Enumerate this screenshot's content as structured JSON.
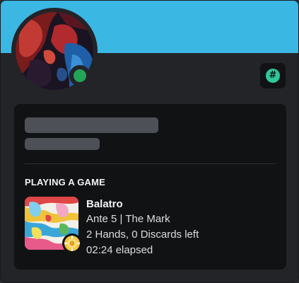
{
  "profile": {
    "banner_color": "#3bb7e4",
    "status": "online",
    "status_color": "#23a559",
    "badge_icon": "hashtag-icon",
    "badge_symbol": "#",
    "badge_color": "#2fc79a"
  },
  "activity": {
    "header": "PLAYING A GAME",
    "game_name": "Balatro",
    "details": "Ante 5 | The Mark",
    "state": "2 Hands, 0 Discards left",
    "elapsed": "02:24 elapsed",
    "small_image_icon": "joker-chip-icon"
  }
}
